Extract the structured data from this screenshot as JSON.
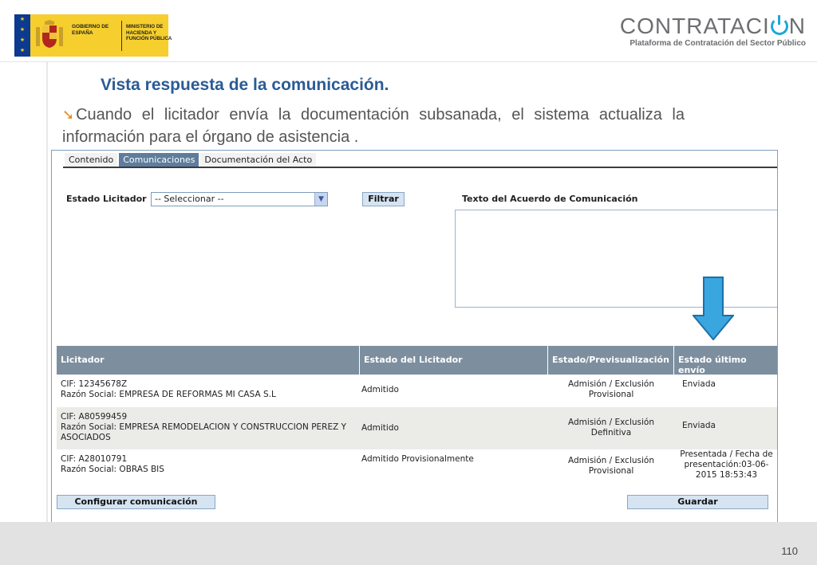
{
  "header": {
    "gov_text": "GOBIERNO DE ESPAÑA",
    "ministry_text": "MINISTERIO DE HACIENDA Y FUNCIÓN PÚBLICA",
    "brand_title_left": "CONTRATACI",
    "brand_title_right": "N",
    "brand_subtitle": "Plataforma de Contratación del Sector Público"
  },
  "slide": {
    "title": "Vista respuesta de la comunicación.",
    "bullet": "Cuando el licitador envía la documentación subsanada, el sistema actualiza la información para el órgano de asistencia ."
  },
  "app": {
    "tabs": [
      {
        "label": "Contenido",
        "active": false
      },
      {
        "label": "Comunicaciones",
        "active": true
      },
      {
        "label": "Documentación del Acto",
        "active": false
      }
    ],
    "estado_label": "Estado Licitador",
    "select_value": "-- Seleccionar --",
    "filtrar_label": "Filtrar",
    "texto_label": "Texto del Acuerdo de Comunicación",
    "columns": [
      "Licitador",
      "Estado del Licitador",
      "Estado/Previsualización",
      "Estado último envío"
    ],
    "rows": [
      {
        "cif": "CIF: 12345678Z",
        "razon": "Razón Social: EMPRESA DE REFORMAS MI CASA S.L",
        "estado": "Admitido",
        "previsualizacion": "Admisión / Exclusión Provisional",
        "ultimo_envio": "Enviada"
      },
      {
        "cif": "CIF: A80599459",
        "razon": "Razón Social: EMPRESA REMODELACION Y CONSTRUCCION PEREZ Y ASOCIADOS",
        "estado": "Admitido",
        "previsualizacion": "Admisión / Exclusión Definitiva",
        "ultimo_envio": "Enviada"
      },
      {
        "cif": "CIF: A28010791",
        "razon": "Razón Social: OBRAS BIS",
        "estado": "Admitido Provisionalmente",
        "previsualizacion": "Admisión / Exclusión Provisional",
        "ultimo_envio": "Presentada / Fecha de presentación:03-06-2015 18:53:43"
      }
    ],
    "configurar_label": "Configurar comunicación",
    "guardar_label": "Guardar"
  },
  "footer": {
    "page_number": "110"
  },
  "colors": {
    "title": "#2b5b95",
    "brand_accent": "#1fa7d8",
    "arrow": "#3aa6e0",
    "header_row": "#7d8f9f"
  }
}
